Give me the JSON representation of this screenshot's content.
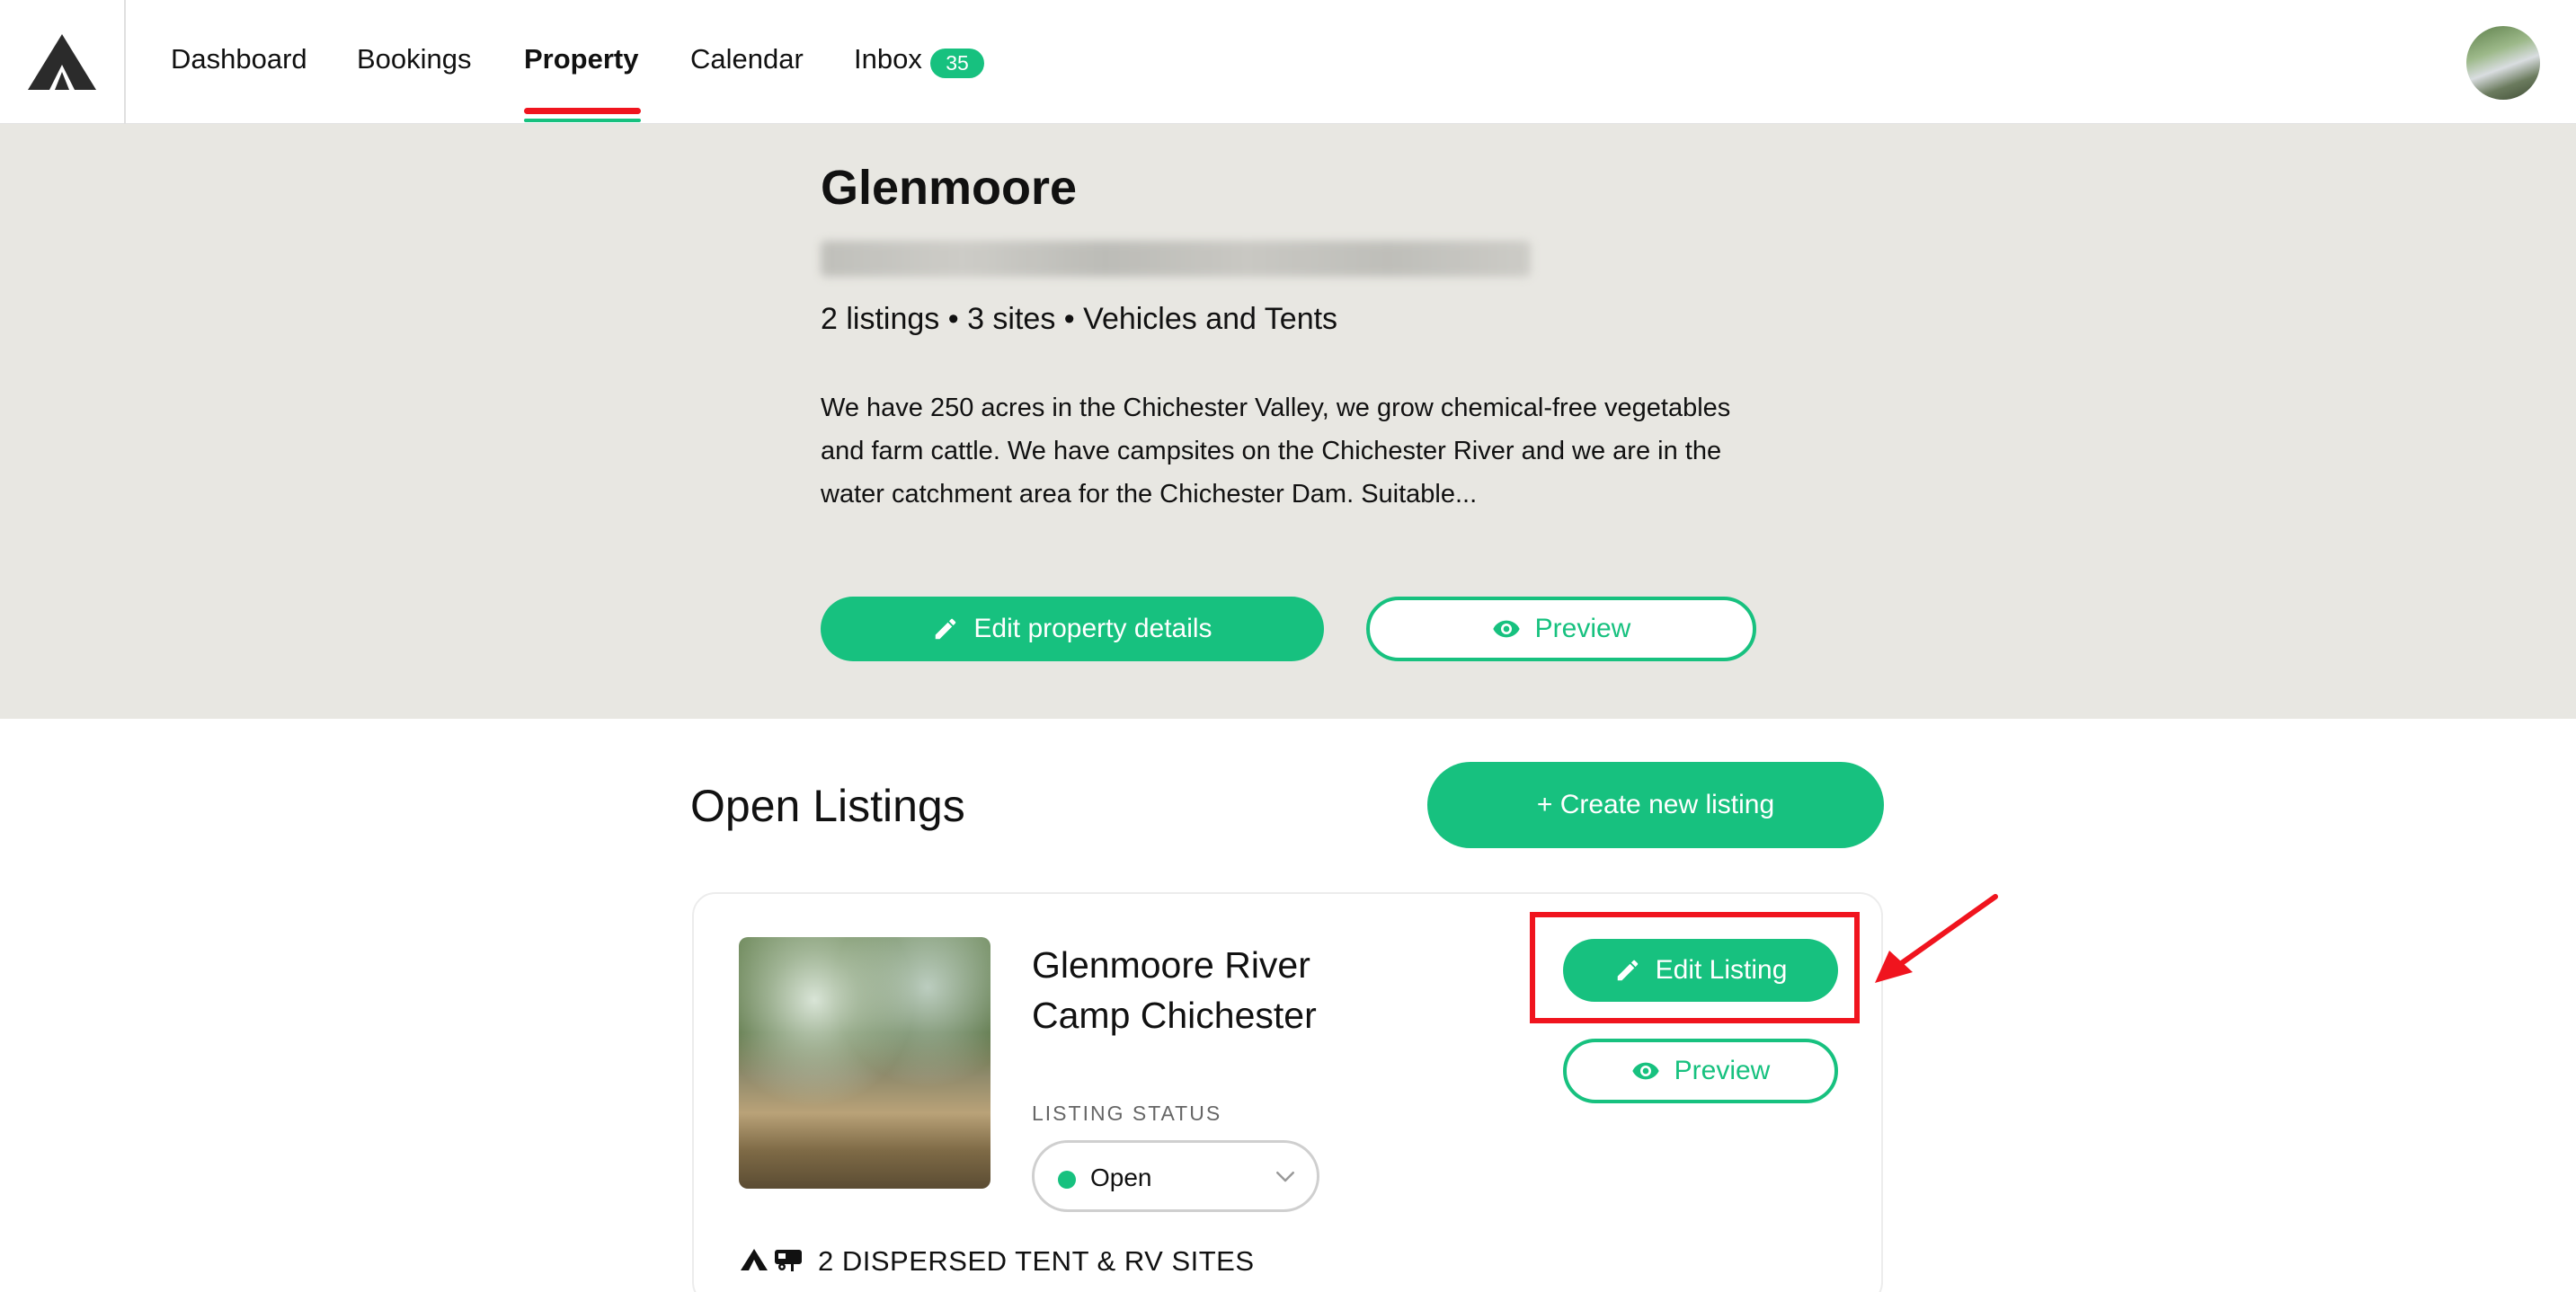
{
  "nav": {
    "items": [
      {
        "label": "Dashboard"
      },
      {
        "label": "Bookings"
      },
      {
        "label": "Property"
      },
      {
        "label": "Calendar"
      },
      {
        "label": "Inbox"
      }
    ],
    "active": "Property",
    "inbox_count": "35"
  },
  "property": {
    "title": "Glenmoore",
    "meta": "2 listings • 3 sites • Vehicles and Tents",
    "description": "We have 250 acres in the Chichester Valley, we grow chemical-free vegetables and farm cattle. We have campsites on the Chichester River and we are in the water catchment area for the Chichester Dam. Suitable...",
    "edit_button": "Edit property details",
    "preview_button": "Preview"
  },
  "listings": {
    "section_title": "Open Listings",
    "create_button": "+ Create new listing",
    "items": [
      {
        "title": "Glenmoore River Camp Chichester",
        "status_label": "LISTING STATUS",
        "status_value": "Open",
        "edit_button": "Edit Listing",
        "preview_button": "Preview",
        "sites": "2 DISPERSED TENT & RV SITES"
      }
    ]
  },
  "colors": {
    "accent": "#17c17f",
    "hero_bg": "#e8e7e2",
    "highlight": "#f0141e"
  },
  "icons": [
    "logo-tent-icon",
    "pencil-icon",
    "eye-icon",
    "chevron-down-icon",
    "tent-icon",
    "rv-icon",
    "arrow-annotation"
  ]
}
